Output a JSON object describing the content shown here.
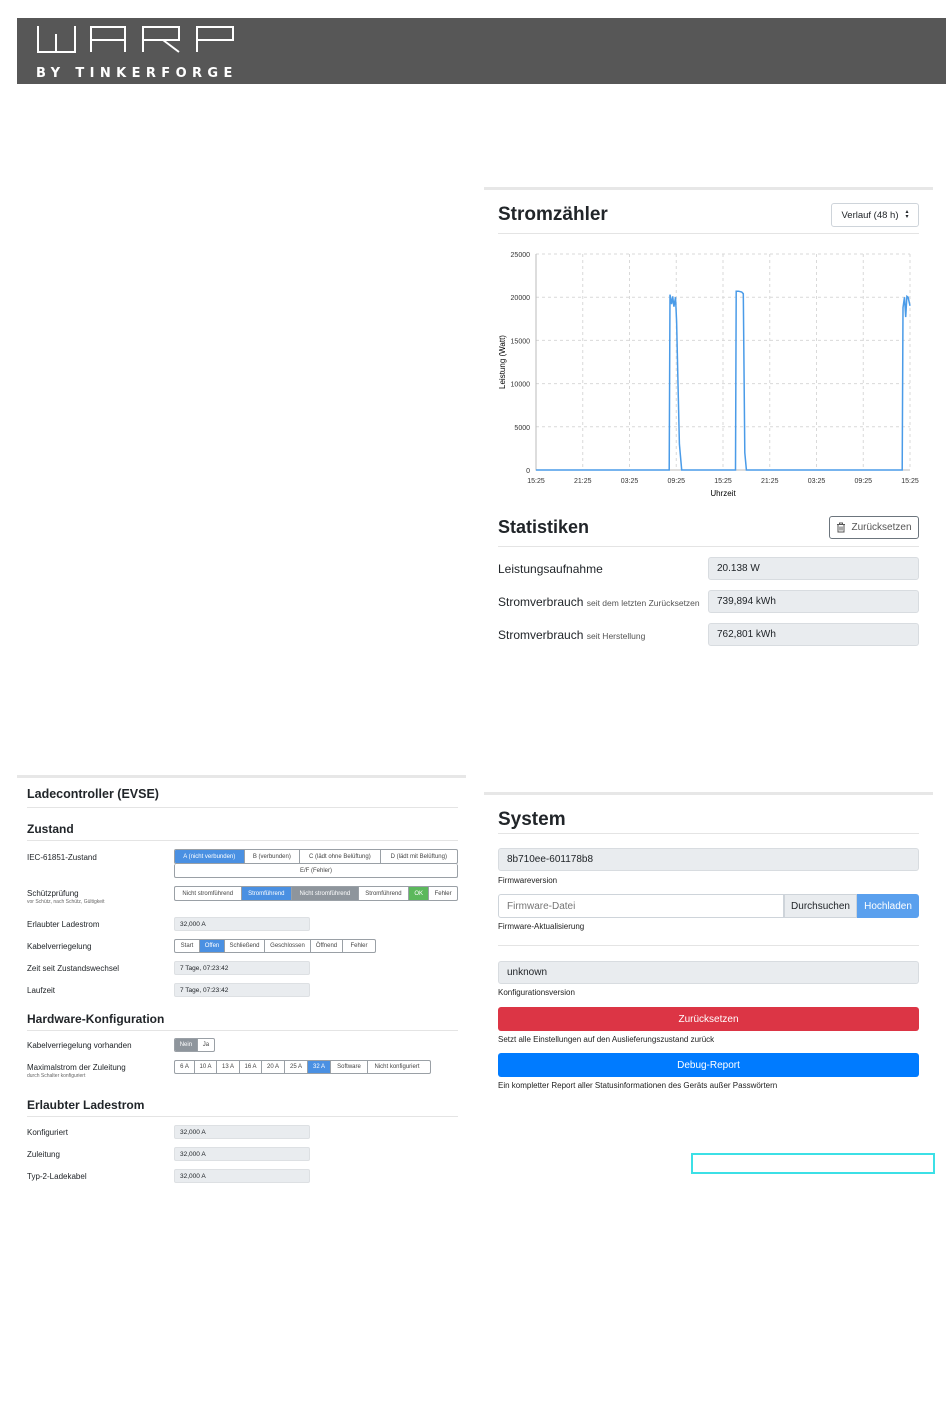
{
  "header": {
    "logo_text": "WARP",
    "logo_sub": "BY TINKERFORGE"
  },
  "meter": {
    "title": "Stromzähler",
    "select_value": "Verlauf (48 h)",
    "chart": {
      "ylabel": "Leistung (Watt)",
      "xlabel": "Uhrzeit",
      "y_ticks": [
        "25000",
        "20000",
        "15000",
        "10000",
        "5000",
        "0"
      ],
      "x_ticks": [
        "15:25",
        "21:25",
        "03:25",
        "09:25",
        "15:25",
        "21:25",
        "03:25",
        "09:25",
        "15:25"
      ]
    },
    "stats_title": "Statistiken",
    "reset_label": "Zurücksetzen",
    "rows": [
      {
        "label": "Leistungsaufnahme",
        "sub": "",
        "value": "20.138 W"
      },
      {
        "label": "Stromverbrauch",
        "sub": "seit dem letzten Zurücksetzen",
        "value": "739,894 kWh"
      },
      {
        "label": "Stromverbrauch",
        "sub": "seit Herstellung",
        "value": "762,801 kWh"
      }
    ]
  },
  "chart_data": {
    "type": "line",
    "title": "",
    "xlabel": "Uhrzeit",
    "ylabel": "Leistung (Watt)",
    "ylim": [
      0,
      25000
    ],
    "x_ticks": [
      "15:25",
      "21:25",
      "03:25",
      "09:25",
      "15:25",
      "21:25",
      "03:25",
      "09:25",
      "15:25"
    ],
    "grid": true,
    "series": [
      {
        "hours": [
          0,
          17.1,
          17.2,
          17.4,
          17.55,
          17.7,
          17.9,
          18.05,
          18.2,
          18.4,
          18.7,
          19.0,
          25.6,
          25.7,
          26.0,
          26.4,
          26.6,
          26.8,
          27.0,
          47.0,
          47.1,
          47.3,
          47.45,
          47.6,
          47.75,
          48.0
        ],
        "values": [
          0,
          0,
          20300,
          19200,
          20100,
          18900,
          20000,
          17200,
          11000,
          3000,
          0,
          0,
          0,
          20700,
          20700,
          20600,
          20400,
          2000,
          0,
          0,
          18800,
          20000,
          17700,
          20100,
          20000,
          19000
        ]
      }
    ]
  },
  "evse": {
    "title": "Ladecontroller (EVSE)",
    "zustand_title": "Zustand",
    "iec_label": "IEC-61851-Zustand",
    "iec_options": [
      "A (nicht verbunden)",
      "B (verbunden)",
      "C (lädt ohne Belüftung)",
      "D (lädt mit Belüftung)"
    ],
    "iec_error": "E/F (Fehler)",
    "schuetz_label": "Schützprüfung",
    "schuetz_sub": "vor Schütz, nach Schütz, Gültigkeit",
    "schuetz_options": [
      "Nicht stromführend",
      "Stromführend",
      "Nicht stromführend",
      "Stromführend",
      "OK",
      "Fehler"
    ],
    "erlaubt_label": "Erlaubter Ladestrom",
    "erlaubt_value": "32,000 A",
    "kabel_label": "Kabelverriegelung",
    "kabel_options": [
      "Start",
      "Offen",
      "Schließend",
      "Geschlossen",
      "Öffnend",
      "Fehler"
    ],
    "zeit_label": "Zeit seit Zustandswechsel",
    "zeit_value": "7 Tage, 07:23:42",
    "laufzeit_label": "Laufzeit",
    "laufzeit_value": "7 Tage, 07:23:42",
    "hw_title": "Hardware-Konfiguration",
    "kv_label": "Kabelverriegelung vorhanden",
    "kv_options": [
      "Nein",
      "Ja"
    ],
    "max_label": "Maximalstrom der Zuleitung",
    "max_sub": "durch Schalter konfiguriert",
    "max_options": [
      "6 A",
      "10 A",
      "13 A",
      "16 A",
      "20 A",
      "25 A",
      "32 A",
      "Software",
      "Nicht konfiguriert"
    ],
    "el_title": "Erlaubter Ladestrom",
    "konf_label": "Konfiguriert",
    "konf_value": "32,000 A",
    "zul_label": "Zuleitung",
    "zul_value": "32,000 A",
    "typ2_label": "Typ-2-Ladekabel",
    "typ2_value": "32,000 A"
  },
  "system": {
    "title": "System",
    "fw_version": "8b710ee-601178b8",
    "fw_version_label": "Firmwareversion",
    "fw_file_placeholder": "Firmware-Datei",
    "browse_label": "Durchsuchen",
    "upload_label": "Hochladen",
    "fw_update_label": "Firmware-Aktualisierung",
    "config_version": "unknown",
    "config_version_label": "Konfigurationsversion",
    "reset_label": "Zurücksetzen",
    "reset_desc": "Setzt alle Einstellungen auf den Auslieferungszustand zurück",
    "debug_label": "Debug-Report",
    "debug_desc": "Ein kompletter Report aller Statusinformationen des Geräts außer Passwörtern"
  },
  "colors": {
    "header_bg": "#575757",
    "accent_blue": "#4a90e2",
    "danger": "#dc3545",
    "primary": "#007bff",
    "ok_green": "#5cb85c",
    "chart_line": "#4a9be8"
  }
}
